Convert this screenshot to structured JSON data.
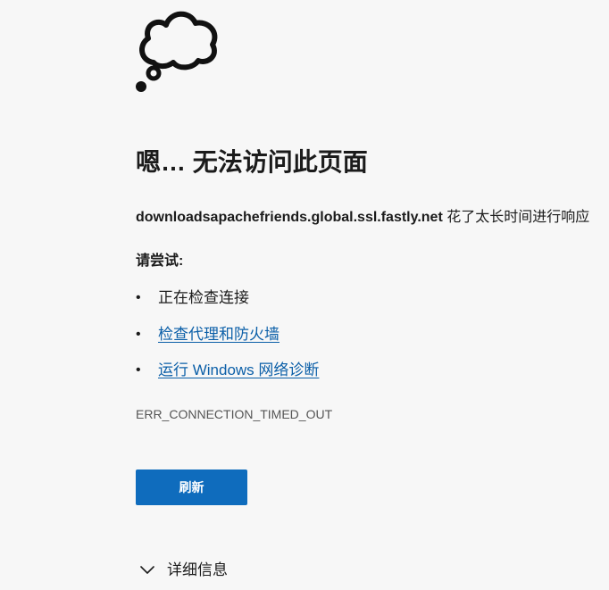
{
  "page": {
    "title": "嗯… 无法访问此页面",
    "host": "downloadsapachefriends.global.ssl.fastly.net",
    "host_message": "花了太长时间进行响应",
    "try_heading": "请尝试:",
    "suggestions": [
      {
        "label": "正在检查连接",
        "is_link": false
      },
      {
        "label": "检查代理和防火墙",
        "is_link": true
      },
      {
        "label": "运行 Windows 网络诊断",
        "is_link": true
      }
    ],
    "bullet": "•",
    "error_code": "ERR_CONNECTION_TIMED_OUT",
    "refresh_label": "刷新",
    "details_label": "详细信息"
  },
  "icons": {
    "cloud": "thought-cloud-icon",
    "details": "chevron-down-icon"
  },
  "colors": {
    "background": "#f7f7f7",
    "text": "#1b1b1b",
    "link": "#0b5fa8",
    "button": "#0f6cbd",
    "error_code": "#555555"
  }
}
